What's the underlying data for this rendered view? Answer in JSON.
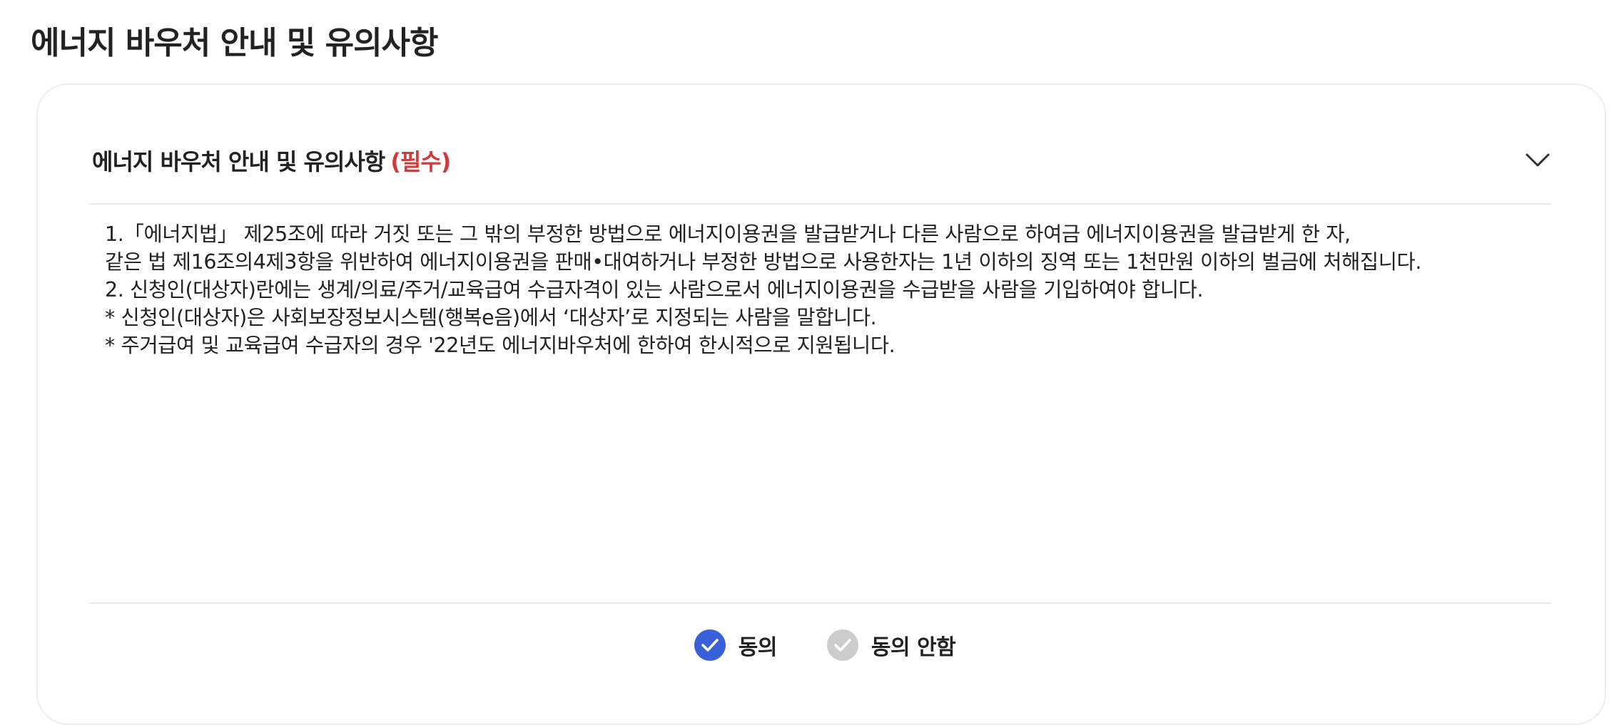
{
  "page": {
    "title": "에너지 바우처 안내 및 유의사항"
  },
  "card": {
    "header_title": "에너지 바우처 안내 및 유의사항",
    "required_label": "(필수)",
    "toggle_icon": "chevron-down-icon",
    "content_lines": [
      "1.「에너지법」 제25조에 따라 거짓 또는 그 밖의 부정한 방법으로 에너지이용권을 발급받거나 다른 사람으로 하여금 에너지이용권을 발급받게 한 자,",
      "같은 법 제16조의4제3항을 위반하여 에너지이용권을 판매•대여하거나 부정한 방법으로 사용한자는 1년 이하의 징역 또는 1천만원 이하의 벌금에 처해집니다.",
      "2. 신청인(대상자)란에는 생계/의료/주거/교육급여 수급자격이 있는 사람으로서 에너지이용권을 수급받을 사람을 기입하여야 합니다.",
      "* 신청인(대상자)은 사회보장정보시스템(행복e음)에서 ‘대상자’로 지정되는 사람을 말합니다.",
      "* 주거급여 및 교육급여 수급자의 경우 '22년도 에너지바우처에 한하여 한시적으로 지원됩니다."
    ]
  },
  "consent": {
    "options": [
      {
        "label": "동의",
        "selected": true,
        "icon": "check-circle-icon",
        "color": "#3860d8"
      },
      {
        "label": "동의 안함",
        "selected": false,
        "icon": "check-circle-icon",
        "color": "#cccccc"
      }
    ]
  },
  "colors": {
    "required": "#d23b3b",
    "accent": "#3860d8",
    "inactive": "#cccccc",
    "border": "#eeeeee"
  }
}
